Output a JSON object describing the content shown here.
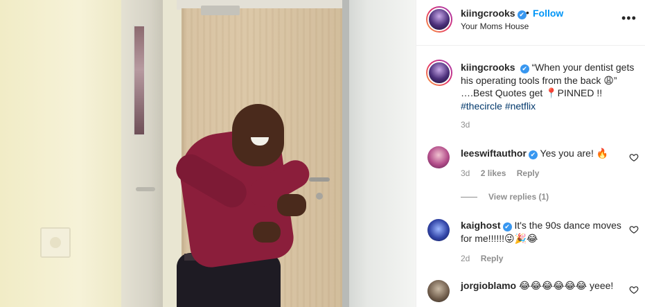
{
  "header": {
    "username": "kiingcrooks",
    "verified_glyph": "✔",
    "dot": "•",
    "follow_label": "Follow",
    "location": "Your Moms House",
    "more_glyph": "•••"
  },
  "caption": {
    "username": "kiingcrooks",
    "text_1": "“When your dentist gets his operating tools from the back 😩” ….Best Quotes get 📍PINNED !!",
    "hashtag_1": "#thecircle",
    "hashtag_2": "#netflix",
    "time": "3d"
  },
  "comments": [
    {
      "username": "leeswiftauthor",
      "verified": true,
      "text": "Yes you are! 🔥",
      "time": "3d",
      "likes": "2 likes",
      "reply": "Reply",
      "view_replies": "View replies (1)"
    },
    {
      "username": "kaighost",
      "verified": true,
      "text": "It's the 90s dance moves for me!!!!!!😜🎉😂",
      "time": "2d",
      "reply": "Reply"
    },
    {
      "username": "jorgioblamo",
      "verified": false,
      "text": "😂😂😂😂😂😂 yeee!"
    }
  ],
  "icons": {
    "heart": "heart-outline-icon",
    "more": "more-horizontal-icon",
    "verified": "verified-badge-icon"
  },
  "colors": {
    "link_blue": "#0095f6",
    "hashtag": "#00376b",
    "verified": "#3897f0",
    "muted": "#8e8e8e",
    "text": "#262626"
  }
}
